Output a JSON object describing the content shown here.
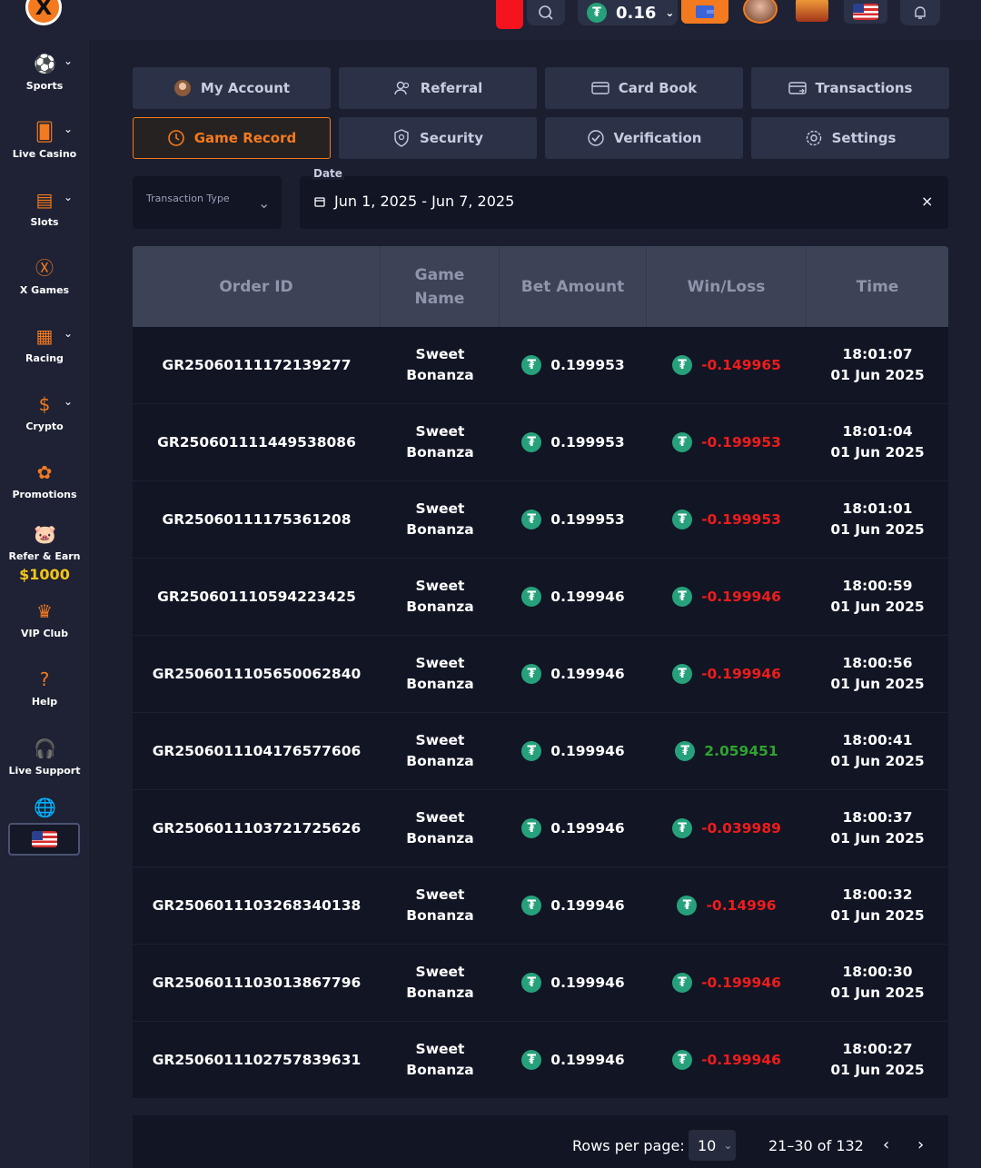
{
  "topbar": {
    "balance": "0.16",
    "currency_icon": "usdt-icon"
  },
  "sidebar": {
    "items": [
      {
        "label": "Sports",
        "icon": "sports-icon",
        "has_chevron": true
      },
      {
        "label": "Live Casino",
        "icon": "live-casino-icon",
        "has_chevron": true
      },
      {
        "label": "Slots",
        "icon": "slots-icon",
        "has_chevron": true
      },
      {
        "label": "X Games",
        "icon": "x-games-icon",
        "has_chevron": false
      },
      {
        "label": "Racing",
        "icon": "racing-flag-icon",
        "has_chevron": true
      },
      {
        "label": "Crypto",
        "icon": "crypto-coin-icon",
        "has_chevron": true
      },
      {
        "label": "Promotions",
        "icon": "promotions-icon",
        "has_chevron": false
      },
      {
        "label": "Refer & Earn",
        "icon": "piggy-bank-icon",
        "has_chevron": false
      },
      {
        "label": "VIP Club",
        "icon": "crown-icon",
        "has_chevron": false
      },
      {
        "label": "Help",
        "icon": "help-icon",
        "has_chevron": false
      },
      {
        "label": "Live Support",
        "icon": "headset-icon",
        "has_chevron": false
      }
    ],
    "refer_amount": "$1000"
  },
  "tabs": [
    {
      "label": "My Account",
      "icon": "avatar-icon",
      "active": false
    },
    {
      "label": "Referral",
      "icon": "users-icon",
      "active": false
    },
    {
      "label": "Card Book",
      "icon": "card-icon",
      "active": false
    },
    {
      "label": "Transactions",
      "icon": "transactions-icon",
      "active": false
    },
    {
      "label": "Game Record",
      "icon": "history-icon",
      "active": true
    },
    {
      "label": "Security",
      "icon": "shield-icon",
      "active": false
    },
    {
      "label": "Verification",
      "icon": "check-circle-icon",
      "active": false
    },
    {
      "label": "Settings",
      "icon": "gear-icon",
      "active": false
    }
  ],
  "filters": {
    "transaction_type_placeholder": "Transaction Type",
    "date_label": "Date",
    "date_value": "Jun 1, 2025 - Jun 7, 2025",
    "clear": "×"
  },
  "table": {
    "headers": [
      "Order ID",
      "Game Name",
      "Bet Amount",
      "Win/Loss",
      "Time"
    ],
    "rows": [
      {
        "order_id": "GR25060111172139277",
        "game_1": "Sweet",
        "game_2": "Bonanza",
        "bet": "0.199953",
        "winloss": "-0.149965",
        "time": "18:01:07",
        "date": "01 Jun 2025",
        "positive": false
      },
      {
        "order_id": "GR250601111449538086",
        "game_1": "Sweet",
        "game_2": "Bonanza",
        "bet": "0.199953",
        "winloss": "-0.199953",
        "time": "18:01:04",
        "date": "01 Jun 2025",
        "positive": false
      },
      {
        "order_id": "GR25060111175361208",
        "game_1": "Sweet",
        "game_2": "Bonanza",
        "bet": "0.199953",
        "winloss": "-0.199953",
        "time": "18:01:01",
        "date": "01 Jun 2025",
        "positive": false
      },
      {
        "order_id": "GR25060111059422342​5",
        "game_1": "Sweet",
        "game_2": "Bonanza",
        "bet": "0.199946",
        "winloss": "-0.199946",
        "time": "18:00:59",
        "date": "01 Jun 2025",
        "positive": false
      },
      {
        "order_id": "GR250601110565006284​0",
        "game_1": "Sweet",
        "game_2": "Bonanza",
        "bet": "0.199946",
        "winloss": "-0.199946",
        "time": "18:00:56",
        "date": "01 Jun 2025",
        "positive": false
      },
      {
        "order_id": "GR250601110417657760​6",
        "game_1": "Sweet",
        "game_2": "Bonanza",
        "bet": "0.199946",
        "winloss": "2.059451",
        "time": "18:00:41",
        "date": "01 Jun 2025",
        "positive": true
      },
      {
        "order_id": "GR250601110372172562​6",
        "game_1": "Sweet",
        "game_2": "Bonanza",
        "bet": "0.199946",
        "winloss": "-0.039989",
        "time": "18:00:37",
        "date": "01 Jun 2025",
        "positive": false
      },
      {
        "order_id": "GR250601110326834013​8",
        "game_1": "Sweet",
        "game_2": "Bonanza",
        "bet": "0.199946",
        "winloss": "-0.14996",
        "time": "18:00:32",
        "date": "01 Jun 2025",
        "positive": false
      },
      {
        "order_id": "GR250601110301386779​6",
        "game_1": "Sweet",
        "game_2": "Bonanza",
        "bet": "0.199946",
        "winloss": "-0.199946",
        "time": "18:00:30",
        "date": "01 Jun 2025",
        "positive": false
      },
      {
        "order_id": "GR250601110275783963​1",
        "game_1": "Sweet",
        "game_2": "Bonanza",
        "bet": "0.199946",
        "winloss": "-0.199946",
        "time": "18:00:27",
        "date": "01 Jun 2025",
        "positive": false
      }
    ]
  },
  "pagination": {
    "rows_per_page_label": "Rows per page:",
    "rows_per_page": "10",
    "range": "21–30 of 132"
  },
  "colors": {
    "accent": "#f47a1f",
    "negative": "#ee1c1c",
    "positive": "#2fa32f",
    "usdt": "#26a17b"
  }
}
